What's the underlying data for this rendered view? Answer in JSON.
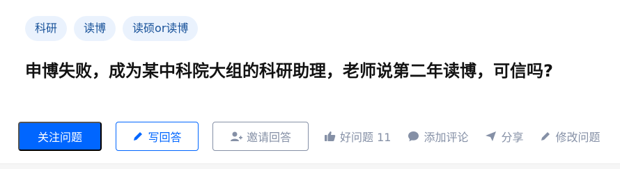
{
  "topics": [
    "科研",
    "读博",
    "读硕or读博"
  ],
  "question": {
    "title": "申博失败，成为某中科院大组的科研助理，老师说第二年读博，可信吗?"
  },
  "actions": {
    "follow_label": "关注问题",
    "write_label": "写回答",
    "invite_label": "邀请回答",
    "good_question_label": "好问题 11",
    "comment_label": "添加评论",
    "share_label": "分享",
    "edit_label": "修改问题"
  },
  "colors": {
    "brand": "#0066ff",
    "muted": "#8590a6",
    "tag_bg": "#eaf2fd",
    "tag_text": "#175199"
  },
  "icons": [
    "pencil-icon",
    "add-user-icon",
    "thumbs-up-icon",
    "comment-icon",
    "share-icon",
    "edit-icon"
  ]
}
